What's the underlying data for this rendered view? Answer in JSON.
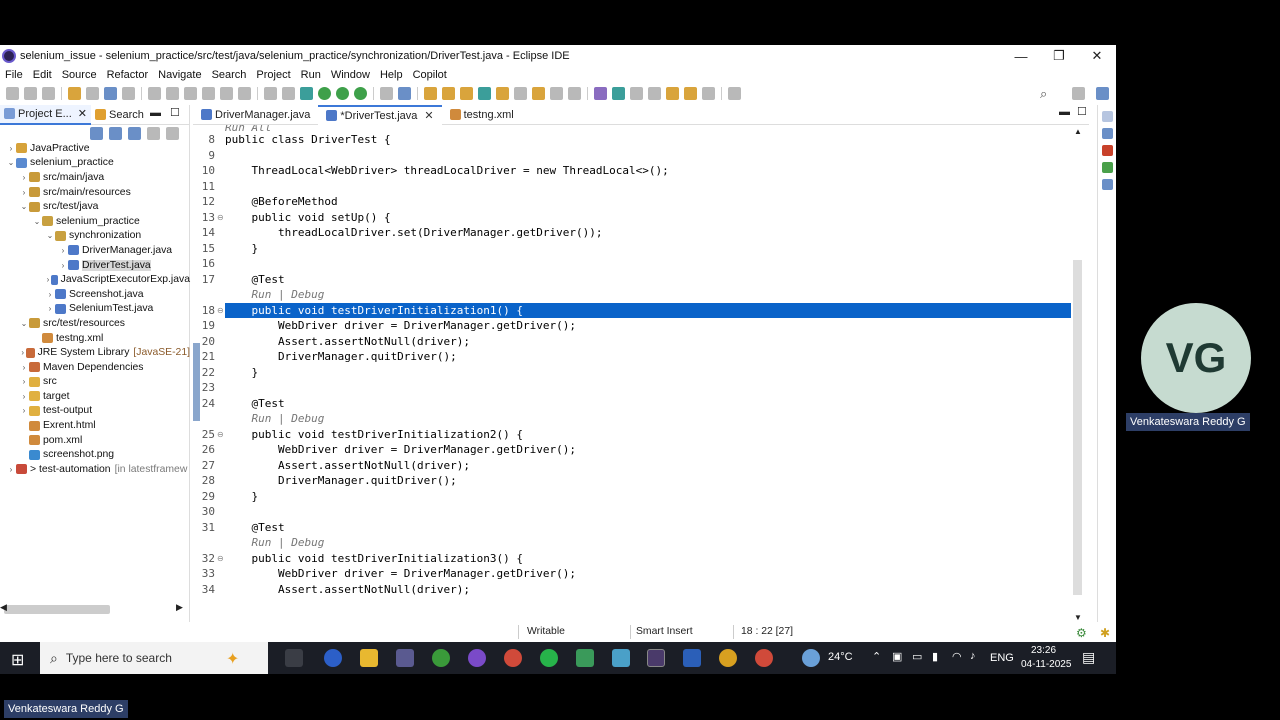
{
  "window": {
    "title": "selenium_issue - selenium_practice/src/test/java/selenium_practice/synchronization/DriverTest.java - Eclipse IDE",
    "minimize": "—",
    "maximize": "❐",
    "close": "✕"
  },
  "menu": [
    "File",
    "Edit",
    "Source",
    "Refactor",
    "Navigate",
    "Search",
    "Project",
    "Run",
    "Window",
    "Help",
    "Copilot"
  ],
  "left_panel": {
    "tabs": [
      "Project E...",
      "Search"
    ],
    "tree": [
      {
        "label": "JavaPractive",
        "tw": "›"
      },
      {
        "label": "selenium_practice",
        "tw": "⌄"
      },
      {
        "label": "src/main/java",
        "tw": "›"
      },
      {
        "label": "src/main/resources",
        "tw": "›"
      },
      {
        "label": "src/test/java",
        "tw": "⌄"
      },
      {
        "label": "selenium_practice",
        "tw": "⌄"
      },
      {
        "label": "synchronization",
        "tw": "⌄"
      },
      {
        "label": "DriverManager.java",
        "tw": "›"
      },
      {
        "label": "DriverTest.java",
        "tw": "›"
      },
      {
        "label": "JavaScriptExecutorExp.java",
        "tw": "›"
      },
      {
        "label": "Screenshot.java",
        "tw": "›"
      },
      {
        "label": "SeleniumTest.java",
        "tw": "›"
      },
      {
        "label": "src/test/resources",
        "tw": "⌄"
      },
      {
        "label": "testng.xml",
        "tw": ""
      },
      {
        "label": "JRE System Library",
        "tw": "›",
        "decoration": "[JavaSE-21]"
      },
      {
        "label": "Maven Dependencies",
        "tw": "›"
      },
      {
        "label": "src",
        "tw": "›"
      },
      {
        "label": "target",
        "tw": "›"
      },
      {
        "label": "test-output",
        "tw": "›"
      },
      {
        "label": "Exrent.html",
        "tw": ""
      },
      {
        "label": "pom.xml",
        "tw": ""
      },
      {
        "label": "screenshot.png",
        "tw": ""
      },
      {
        "label": "> test-automation",
        "tw": "›",
        "decoration": "[in latestframew"
      }
    ]
  },
  "editor": {
    "tabs": [
      "DriverManager.java",
      "*DriverTest.java",
      "testng.xml"
    ],
    "tab_close": "✕",
    "run_all": "Run All",
    "lines": [
      {
        "n": "8",
        "text": "public class DriverTest {"
      },
      {
        "n": "9",
        "text": ""
      },
      {
        "n": "10",
        "text": "    ThreadLocal<WebDriver> threadLocalDriver = new ThreadLocal<>();"
      },
      {
        "n": "11",
        "text": ""
      },
      {
        "n": "12",
        "text": "    @BeforeMethod"
      },
      {
        "n": "13",
        "text": "    public void setUp() {"
      },
      {
        "n": "14",
        "text": "        threadLocalDriver.set(DriverManager.getDriver());"
      },
      {
        "n": "15",
        "text": "    }"
      },
      {
        "n": "16",
        "text": ""
      },
      {
        "n": "17",
        "text": "    @Test"
      },
      {
        "n": "",
        "text": "    Run | Debug"
      },
      {
        "n": "18",
        "text": "    public void testDriverInitialization1() {"
      },
      {
        "n": "19",
        "text": "        WebDriver driver = DriverManager.getDriver();"
      },
      {
        "n": "20",
        "text": "        Assert.assertNotNull(driver);"
      },
      {
        "n": "21",
        "text": "        DriverManager.quitDriver();"
      },
      {
        "n": "22",
        "text": "    }"
      },
      {
        "n": "23",
        "text": ""
      },
      {
        "n": "24",
        "text": "    @Test"
      },
      {
        "n": "",
        "text": "    Run | Debug"
      },
      {
        "n": "25",
        "text": "    public void testDriverInitialization2() {"
      },
      {
        "n": "26",
        "text": "        WebDriver driver = DriverManager.getDriver();"
      },
      {
        "n": "27",
        "text": "        Assert.assertNotNull(driver);"
      },
      {
        "n": "28",
        "text": "        DriverManager.quitDriver();"
      },
      {
        "n": "29",
        "text": "    }"
      },
      {
        "n": "30",
        "text": ""
      },
      {
        "n": "31",
        "text": "    @Test"
      },
      {
        "n": "",
        "text": "    Run | Debug"
      },
      {
        "n": "32",
        "text": "    public void testDriverInitialization3() {"
      },
      {
        "n": "33",
        "text": "        WebDriver driver = DriverManager.getDriver();"
      },
      {
        "n": "34",
        "text": "        Assert.assertNotNull(driver);"
      }
    ]
  },
  "status": {
    "writable": "Writable",
    "insert_mode": "Smart Insert",
    "position": "18 : 22 [27]"
  },
  "taskbar": {
    "search_placeholder": "Type here to search",
    "weather": "24°C",
    "language": "ENG",
    "time": "23:26",
    "date": "04-11-2025"
  },
  "webcam": {
    "initials": "VG",
    "presenter": "Venkateswara Reddy G"
  }
}
